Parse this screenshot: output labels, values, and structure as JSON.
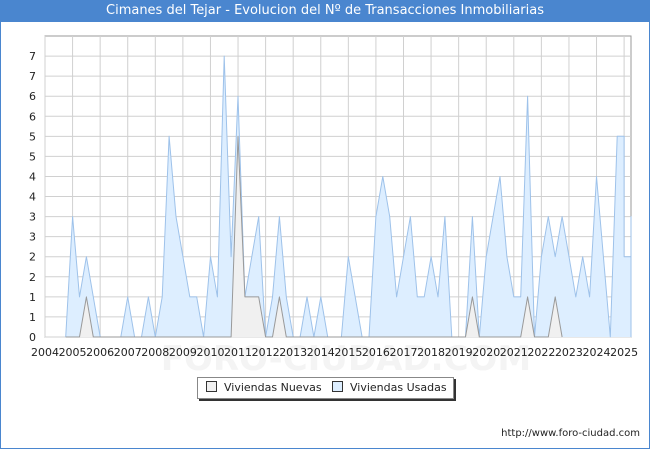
{
  "title": "Cimanes del Tejar - Evolucion del Nº de Transacciones Inmobiliarias",
  "source": "http://www.foro-ciudad.com",
  "watermark": "FORO-CIUDAD.COM",
  "legend": {
    "new_label": "Viviendas Nuevas",
    "used_label": "Viviendas Usadas"
  },
  "colors": {
    "title_bg": "#4a86cf",
    "used_fill": "#ddeeff",
    "used_line": "#9ec2ea",
    "new_fill": "#f0f0f0",
    "new_line": "#999999",
    "grid": "#d0d0d0"
  },
  "chart_data": {
    "type": "area",
    "y_tick_labels": [
      "0",
      "1",
      "1",
      "2",
      "2",
      "3",
      "3",
      "4",
      "4",
      "5",
      "5",
      "6",
      "6",
      "7",
      "7"
    ],
    "x_tick_labels": [
      "2004",
      "2005",
      "2006",
      "2007",
      "2008",
      "2009",
      "2010",
      "2011",
      "2012",
      "2013",
      "2014",
      "2015",
      "2016",
      "2017",
      "2018",
      "2019",
      "2020",
      "2021",
      "2022",
      "2023",
      "2024",
      "2025"
    ],
    "xlim": [
      2004,
      2025.25
    ],
    "ylim": [
      0,
      7.5
    ],
    "grid": true,
    "legend_position": "bottom-center",
    "series": [
      {
        "name": "Viviendas Usadas",
        "points": [
          [
            2004.75,
            0
          ],
          [
            2005,
            3
          ],
          [
            2005.25,
            1
          ],
          [
            2005.5,
            2
          ],
          [
            2005.75,
            1
          ],
          [
            2006,
            0
          ],
          [
            2006.25,
            0
          ],
          [
            2006.5,
            0
          ],
          [
            2006.75,
            0
          ],
          [
            2007,
            1
          ],
          [
            2007.25,
            0
          ],
          [
            2007.5,
            0
          ],
          [
            2007.75,
            1
          ],
          [
            2008,
            0
          ],
          [
            2008.25,
            1
          ],
          [
            2008.5,
            5
          ],
          [
            2008.75,
            3
          ],
          [
            2009,
            2
          ],
          [
            2009.25,
            1
          ],
          [
            2009.5,
            1
          ],
          [
            2009.75,
            0
          ],
          [
            2010,
            2
          ],
          [
            2010.25,
            1
          ],
          [
            2010.5,
            7
          ],
          [
            2010.75,
            2
          ],
          [
            2011,
            6
          ],
          [
            2011.25,
            1
          ],
          [
            2011.5,
            2
          ],
          [
            2011.75,
            3
          ],
          [
            2012,
            0
          ],
          [
            2012.25,
            1
          ],
          [
            2012.5,
            3
          ],
          [
            2012.75,
            1
          ],
          [
            2013,
            0
          ],
          [
            2013.25,
            0
          ],
          [
            2013.5,
            1
          ],
          [
            2013.75,
            0
          ],
          [
            2014,
            1
          ],
          [
            2014.25,
            0
          ],
          [
            2014.5,
            0
          ],
          [
            2014.75,
            0
          ],
          [
            2015,
            2
          ],
          [
            2015.25,
            1
          ],
          [
            2015.5,
            0
          ],
          [
            2015.75,
            0
          ],
          [
            2016,
            3
          ],
          [
            2016.25,
            4
          ],
          [
            2016.5,
            3
          ],
          [
            2016.75,
            1
          ],
          [
            2017,
            2
          ],
          [
            2017.25,
            3
          ],
          [
            2017.5,
            1
          ],
          [
            2017.75,
            1
          ],
          [
            2018,
            2
          ],
          [
            2018.25,
            1
          ],
          [
            2018.5,
            3
          ],
          [
            2018.75,
            0
          ],
          [
            2019,
            0
          ],
          [
            2019.25,
            0
          ],
          [
            2019.5,
            3
          ],
          [
            2019.75,
            0
          ],
          [
            2020,
            2
          ],
          [
            2020.25,
            3
          ],
          [
            2020.5,
            4
          ],
          [
            2020.75,
            2
          ],
          [
            2021,
            1
          ],
          [
            2021.25,
            1
          ],
          [
            2021.5,
            6
          ],
          [
            2021.75,
            0
          ],
          [
            2022,
            2
          ],
          [
            2022.25,
            3
          ],
          [
            2022.5,
            2
          ],
          [
            2022.75,
            3
          ],
          [
            2023,
            2
          ],
          [
            2023.25,
            1
          ],
          [
            2023.5,
            2
          ],
          [
            2023.75,
            1
          ],
          [
            2024,
            4
          ],
          [
            2024.25,
            2
          ],
          [
            2024.5,
            0
          ],
          [
            2024.75,
            5
          ],
          [
            2025,
            5
          ],
          [
            2025,
            2
          ],
          [
            2025.25,
            2
          ],
          [
            2025.5,
            2
          ],
          [
            2025.75,
            3
          ],
          [
            2026,
            0
          ]
        ]
      },
      {
        "name": "Viviendas Nuevas",
        "points": [
          [
            2004.75,
            0
          ],
          [
            2005,
            0
          ],
          [
            2005.25,
            0
          ],
          [
            2005.5,
            1
          ],
          [
            2005.75,
            0
          ],
          [
            2010.75,
            0
          ],
          [
            2011,
            5
          ],
          [
            2011.25,
            1
          ],
          [
            2011.5,
            1
          ],
          [
            2011.75,
            1
          ],
          [
            2012,
            0
          ],
          [
            2012.25,
            0
          ],
          [
            2012.5,
            1
          ],
          [
            2012.75,
            0
          ],
          [
            2019.25,
            0
          ],
          [
            2019.5,
            1
          ],
          [
            2019.75,
            0
          ],
          [
            2021.25,
            0
          ],
          [
            2021.5,
            1
          ],
          [
            2021.75,
            0
          ],
          [
            2022.25,
            0
          ],
          [
            2022.5,
            1
          ],
          [
            2022.75,
            0
          ]
        ]
      }
    ]
  }
}
